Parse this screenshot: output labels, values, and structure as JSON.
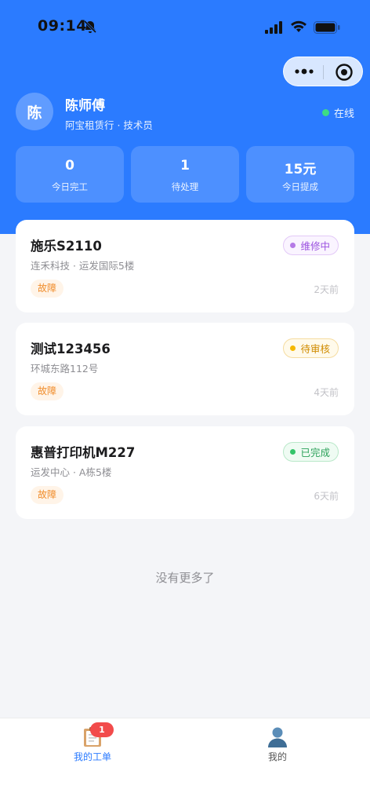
{
  "status_bar": {
    "time": "09:14"
  },
  "profile": {
    "avatar_char": "陈",
    "name": "陈师傅",
    "subtitle": "阿宝租赁行 · 技术员",
    "status": "在线"
  },
  "stats": [
    {
      "value": "0",
      "label": "今日完工"
    },
    {
      "value": "1",
      "label": "待处理"
    },
    {
      "value": "15元",
      "label": "今日提成"
    }
  ],
  "orders": [
    {
      "title": "施乐S2110",
      "address": "连禾科技 · 运发国际5楼",
      "tag": "故障",
      "status": "维修中",
      "status_color": "#9b51e0",
      "time": "2天前"
    },
    {
      "title": "测试123456",
      "address": "环城东路112号",
      "tag": "故障",
      "status": "待审核",
      "status_color": "#d08b00",
      "time": "4天前"
    },
    {
      "title": "惠普打印机M227",
      "address": "运发中心 · A栋5楼",
      "tag": "故障",
      "status": "已完成",
      "status_color": "#2ba15a",
      "time": "6天前"
    }
  ],
  "list_end": "没有更多了",
  "tabbar": {
    "items": [
      {
        "label": "我的工单",
        "icon": "clipboard-icon",
        "badge": "1"
      },
      {
        "label": "我的",
        "icon": "user-icon"
      }
    ]
  },
  "colors": {
    "primary": "#2b7bff",
    "online": "#3ddc84",
    "tag": "#f08c2a",
    "badge": "#f24b4b"
  }
}
